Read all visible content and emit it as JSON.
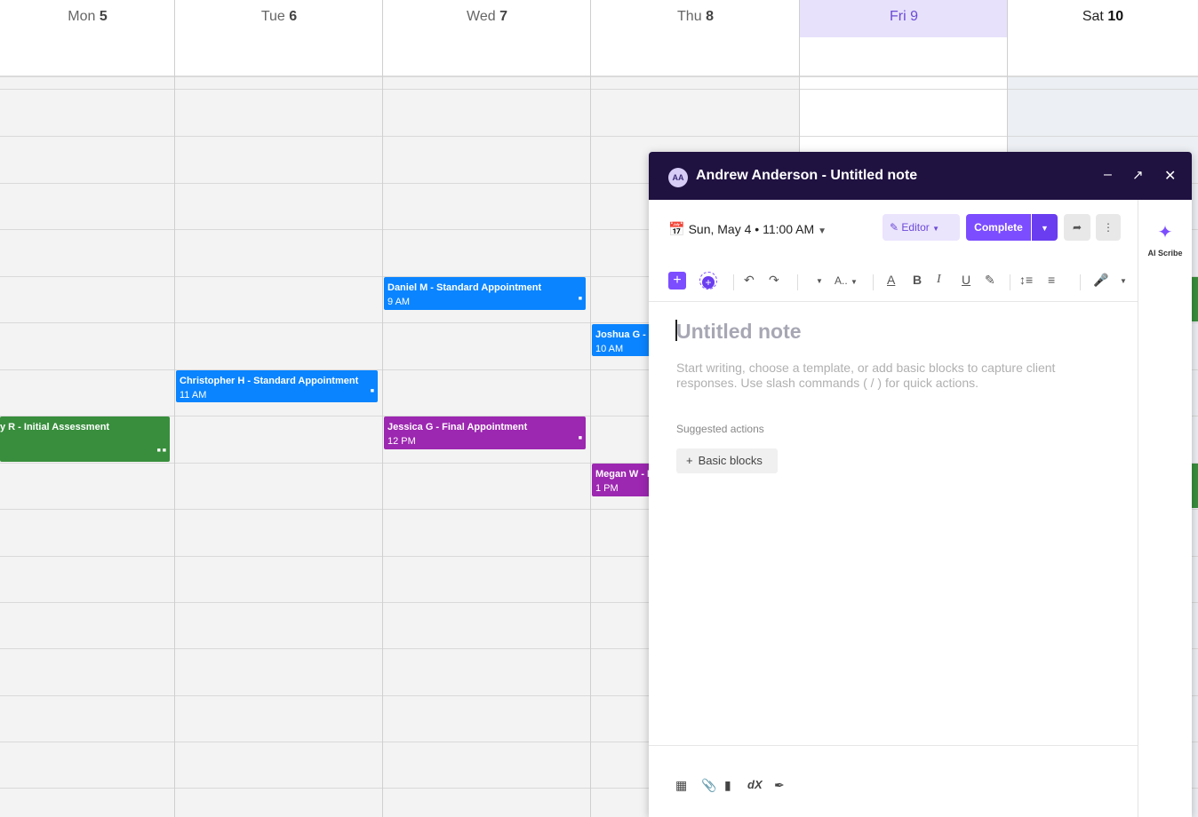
{
  "calendar": {
    "days": [
      {
        "name": "Mon",
        "num": "5"
      },
      {
        "name": "Tue",
        "num": "6"
      },
      {
        "name": "Wed",
        "num": "7"
      },
      {
        "name": "Thu",
        "num": "8"
      },
      {
        "name": "Fri",
        "num": "9"
      },
      {
        "name": "Sat",
        "num": "10"
      }
    ],
    "today": "Fri",
    "events": [
      {
        "title": "Daniel M - Standard Appointment",
        "time": "9 AM",
        "color": "#0a84ff"
      },
      {
        "title": "Joshua G -",
        "time": "10 AM",
        "color": "#0a84ff"
      },
      {
        "title": "Christopher H - Standard Appointment",
        "time": "11 AM",
        "color": "#0a84ff"
      },
      {
        "title": "y R - Initial Assessment",
        "time": "",
        "color": "#388e3c"
      },
      {
        "title": "Jessica G - Final Appointment",
        "time": "12 PM",
        "color": "#9c27b0"
      },
      {
        "title": "Megan W - I",
        "time": "1 PM",
        "color": "#9c27b0"
      }
    ]
  },
  "note": {
    "avatar_initials": "AA",
    "title": "Andrew Anderson - Untitled note",
    "date": "Sun, May 4 • 11:00 AM",
    "editor_label": "Editor",
    "complete_label": "Complete",
    "placeholder": "Untitled note",
    "hint": "Start writing, choose a template, or add basic blocks to capture client responses. Use slash commands ( / ) for quick actions.",
    "suggested_label": "Suggested actions",
    "basic_blocks": "Basic blocks",
    "ai_scribe": "AI Scribe",
    "font_size_label": "A..",
    "footer_dx": "dX"
  },
  "colors": {
    "accent": "#7c4dff",
    "title_bar": "#1f1140",
    "today_bg": "#e7e1fb"
  }
}
